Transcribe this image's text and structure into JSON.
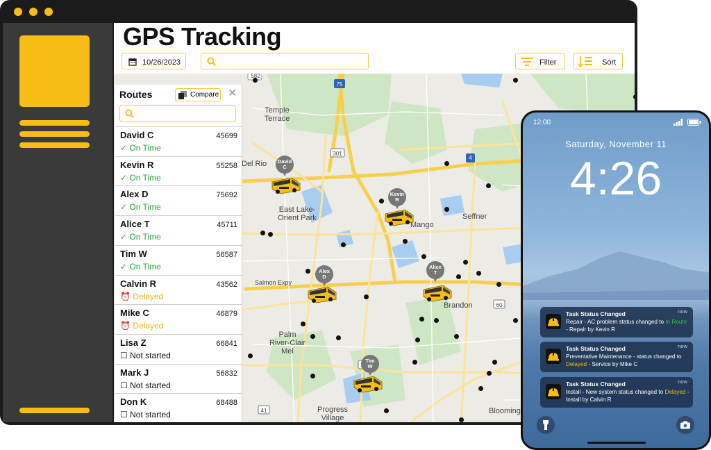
{
  "app": {
    "title": "GPS Tracking"
  },
  "toolbar": {
    "date": "10/26/2023",
    "search_placeholder": "",
    "filter_label": "Filter",
    "sort_label": "Sort"
  },
  "routes_panel": {
    "title": "Routes",
    "compare_label": "Compare",
    "close_glyph": "✕",
    "search_placeholder": "",
    "routes": [
      {
        "name": "David C",
        "number": "45699",
        "status": "On Time",
        "status_icon": "✓"
      },
      {
        "name": "Kevin R",
        "number": "55258",
        "status": "On Time",
        "status_icon": "✓"
      },
      {
        "name": "Alex D",
        "number": "75692",
        "status": "On Time",
        "status_icon": "✓"
      },
      {
        "name": "Alice T",
        "number": "45711",
        "status": "On Time",
        "status_icon": "✓"
      },
      {
        "name": "Tim W",
        "number": "56587",
        "status": "On Time",
        "status_icon": "✓"
      },
      {
        "name": "Calvin R",
        "number": "43562",
        "status": "Delayed",
        "status_icon": "⏰"
      },
      {
        "name": "Mike C",
        "number": "46879",
        "status": "Delayed",
        "status_icon": "⏰"
      },
      {
        "name": "Lisa Z",
        "number": "66841",
        "status": "Not started",
        "status_icon": "☐"
      },
      {
        "name": "Mark J",
        "number": "56832",
        "status": "Not started",
        "status_icon": "☐"
      },
      {
        "name": "Don K",
        "number": "68488",
        "status": "Not started",
        "status_icon": "☐"
      }
    ]
  },
  "map": {
    "places": [
      "Temple Terrace",
      "Del Rio",
      "East Lake-Orient Park",
      "Mango",
      "Seffner",
      "Salmon Expy",
      "Brandon",
      "Palm River-Clair Mel",
      "Progress Village",
      "Blooming"
    ],
    "road_shields": [
      "582",
      "75",
      "301",
      "4",
      "60",
      "41",
      "301"
    ],
    "pins": [
      {
        "line1": "David",
        "line2": "C"
      },
      {
        "line1": "Kevin",
        "line2": "R"
      },
      {
        "line1": "Alex",
        "line2": "D"
      },
      {
        "line1": "Alice",
        "line2": "T"
      },
      {
        "line1": "Tim",
        "line2": "W"
      }
    ]
  },
  "phone": {
    "status_time": "12:00",
    "date": "Saturday, November 11",
    "time": "4:26",
    "notifications": [
      {
        "title": "Task Status Changed",
        "time": "now",
        "pre": "Repair - AC problem status changed to ",
        "highlight": "In Route",
        "highlight_color": "#35c24a",
        "post": " - Repair by Kevin R"
      },
      {
        "title": "Task Status Changed",
        "time": "now",
        "pre": "Preventative Maintenance - status changed to ",
        "highlight": "Delayed",
        "highlight_color": "#f5bd16",
        "post": " - Service by Mike C"
      },
      {
        "title": "Task Status Changed",
        "time": "now",
        "pre": "Install - New system status changed to ",
        "highlight": "Delayed",
        "highlight_color": "#f5bd16",
        "post": " - Install by Calvin R"
      }
    ]
  },
  "colors": {
    "accent": "#f5bd16",
    "on_time": "#2aa53a",
    "delayed": "#f0b400",
    "frame": "#1b1b1b",
    "sidebar": "#3a3a3a"
  },
  "icons": [
    "calendar-icon",
    "search-icon",
    "filter-icon",
    "sort-icon",
    "compare-icon",
    "close-icon",
    "check-icon",
    "alarm-icon",
    "square-icon",
    "flashlight-icon",
    "camera-icon",
    "helmet-icon",
    "wifi-icon",
    "battery-icon",
    "bus-icon",
    "map-pin-icon"
  ]
}
